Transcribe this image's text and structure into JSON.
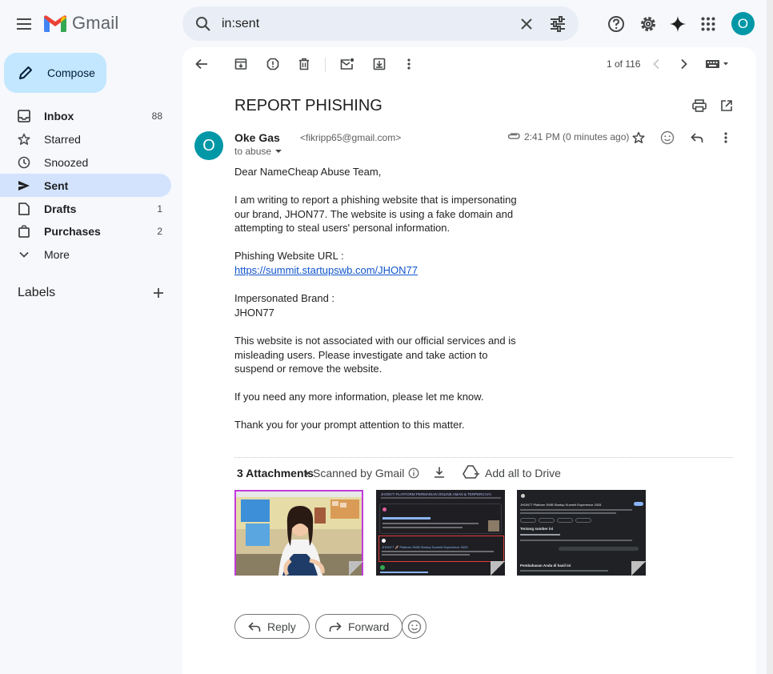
{
  "app": {
    "name": "Gmail"
  },
  "search": {
    "value": "in:sent"
  },
  "sidebar": {
    "compose_label": "Compose",
    "items": [
      {
        "label": "Inbox",
        "count": "88",
        "icon": "inbox-icon",
        "bold": true
      },
      {
        "label": "Starred",
        "count": "",
        "icon": "star-icon",
        "bold": false
      },
      {
        "label": "Snoozed",
        "count": "",
        "icon": "clock-icon",
        "bold": false
      },
      {
        "label": "Sent",
        "count": "",
        "icon": "send-icon",
        "bold": true
      },
      {
        "label": "Drafts",
        "count": "1",
        "icon": "draft-icon",
        "bold": true
      },
      {
        "label": "Purchases",
        "count": "2",
        "icon": "shopping-bag-icon",
        "bold": true
      },
      {
        "label": "More",
        "count": "",
        "icon": "chevron-down-icon",
        "bold": false
      }
    ],
    "labels_title": "Labels"
  },
  "account": {
    "initial": "O",
    "color": "#0097a7"
  },
  "toolbar": {
    "pager": "1 of 116"
  },
  "email": {
    "subject": "REPORT PHISHING",
    "sender_initial": "O",
    "sender_name": "Oke Gas",
    "sender_email": "<fikripp65@gmail.com>",
    "to_line": "to abuse",
    "time": "2:41 PM (0 minutes ago)",
    "body": {
      "greeting": "Dear NameCheap Abuse Team,",
      "p1": "I am writing to report a phishing website that is impersonating our brand, JHON77. The website is using a fake domain and attempting to steal users' personal information.",
      "url_label": "Phishing Website URL :",
      "url": "https://summit.startupswb.com/JHON77",
      "brand_label": "Impersonated Brand :",
      "brand": "JHON77",
      "p2": "This website is not associated with our official services and is misleading users. Please investigate and take action to suspend or remove the website.",
      "p3": "If you need any more information, please let me know.",
      "p4": "Thank you for your prompt attention to this matter."
    }
  },
  "attachments": {
    "title": "3 Attachments",
    "scanned": "Scanned by Gmail",
    "add_all": "Add all to Drive",
    "thumb2_header": "JHON77 PLATFORM PERMAINAN ONLINE AMAN & TERPERCAYA",
    "thumb2_link": "JHON77 🚀 Platform SWB Startup Summit Experience 2025",
    "thumb3_title": "JHON77 Platform SWB Startup Summit Experience 2025",
    "thumb3_section": "Tentang sumber ini",
    "thumb3_section2": "Pembahasan Anda di hasil ini"
  },
  "actions": {
    "reply": "Reply",
    "forward": "Forward"
  },
  "colors": {
    "accent": "#0b57d0",
    "active_nav": "#d3e3fd",
    "compose": "#c2e7ff",
    "avatar": "#0097a7"
  }
}
